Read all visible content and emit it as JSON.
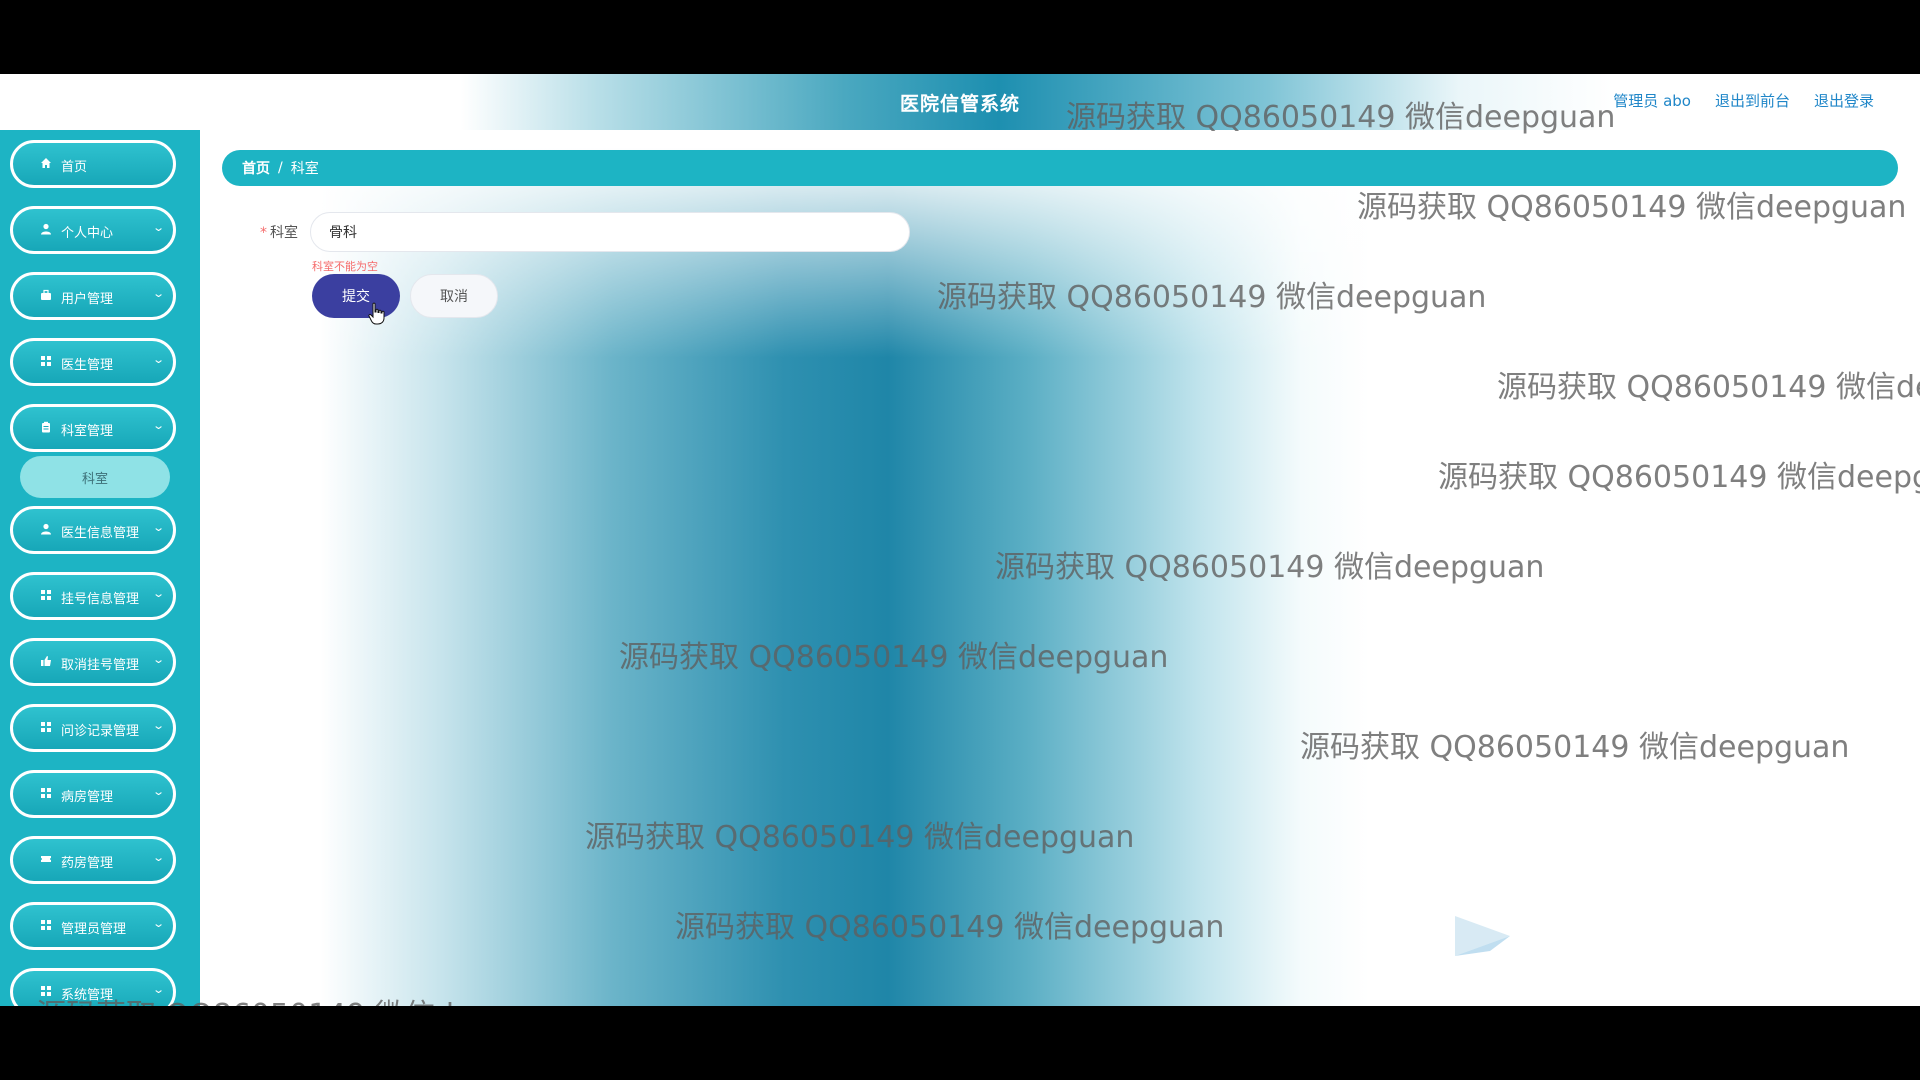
{
  "header": {
    "title": "医院信管系统",
    "user_label": "管理员 abo",
    "back_to_front": "退出到前台",
    "logout": "退出登录"
  },
  "sidebar": {
    "items": [
      {
        "label": "首页",
        "icon": "home-icon"
      },
      {
        "label": "个人中心",
        "icon": "user-icon"
      },
      {
        "label": "用户管理",
        "icon": "briefcase-icon"
      },
      {
        "label": "医生管理",
        "icon": "grid-icon"
      },
      {
        "label": "科室管理",
        "icon": "clipboard-icon"
      },
      {
        "label": "医生信息管理",
        "icon": "user-icon"
      },
      {
        "label": "挂号信息管理",
        "icon": "grid-icon"
      },
      {
        "label": "取消挂号管理",
        "icon": "thumbs-icon"
      },
      {
        "label": "问诊记录管理",
        "icon": "grid-icon"
      },
      {
        "label": "病房管理",
        "icon": "grid-icon"
      },
      {
        "label": "药房管理",
        "icon": "ticket-icon"
      },
      {
        "label": "管理员管理",
        "icon": "grid-icon"
      },
      {
        "label": "系统管理",
        "icon": "grid-icon"
      }
    ],
    "submenu_active": "科室"
  },
  "breadcrumb": {
    "home": "首页",
    "separator": "/",
    "current": "科室"
  },
  "form": {
    "field_label": "科室",
    "required_mark": "*",
    "field_value": "骨科",
    "error_message": "科室不能为空",
    "submit_label": "提交",
    "cancel_label": "取消"
  },
  "watermark": {
    "text": "源码获取 QQ86050149 微信deepguan",
    "partial_1": "源码获取 QQ86050149 微信de",
    "partial_2": "源码获取 QQ86050149 微信deepg"
  },
  "colors": {
    "sidebar_bg": "#1db4c4",
    "submit_bg": "#3b3fa0",
    "error": "#f56c6c",
    "link": "#1f86c8"
  }
}
